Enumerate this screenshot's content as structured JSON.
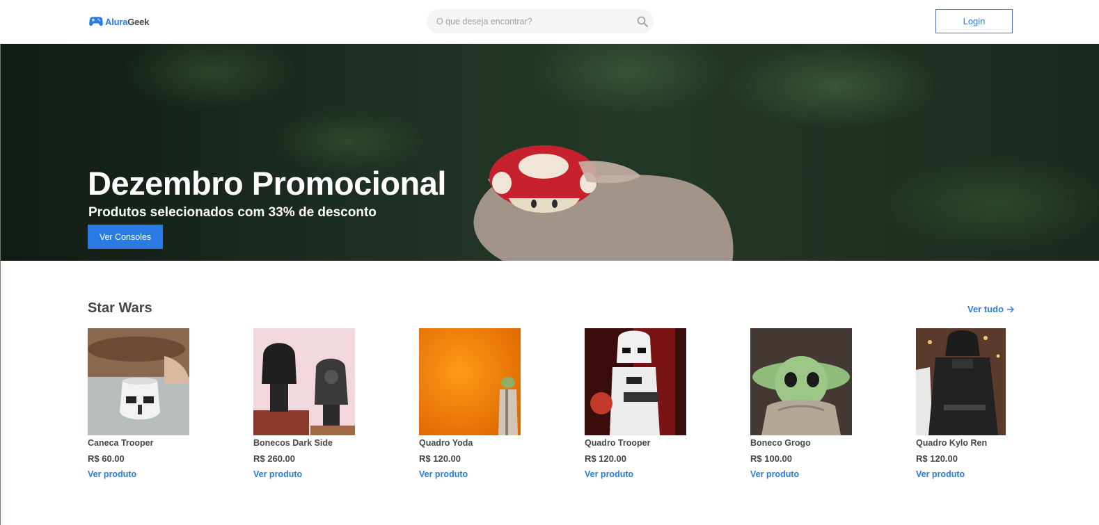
{
  "header": {
    "logo_part1": "Alura",
    "logo_part2": "Geek",
    "logo_icon": "gamepad-icon",
    "search_placeholder": "O que deseja encontrar?",
    "search_icon": "search-icon",
    "login_label": "Login"
  },
  "hero": {
    "title": "Dezembro Promocional",
    "subtitle": "Produtos selecionados com 33% de desconto",
    "button_label": "Ver Consoles"
  },
  "section": {
    "title": "Star Wars",
    "see_all_label": "Ver tudo",
    "see_all_icon": "arrow-right-icon",
    "products": [
      {
        "name": "Caneca Trooper",
        "price": "R$ 60.00",
        "link": "Ver produto"
      },
      {
        "name": "Bonecos Dark Side",
        "price": "R$ 260.00",
        "link": "Ver produto"
      },
      {
        "name": "Quadro Yoda",
        "price": "R$ 120.00",
        "link": "Ver produto"
      },
      {
        "name": "Quadro Trooper",
        "price": "R$ 120.00",
        "link": "Ver produto"
      },
      {
        "name": "Boneco Grogo",
        "price": "R$ 100.00",
        "link": "Ver produto"
      },
      {
        "name": "Quadro Kylo Ren",
        "price": "R$ 120.00",
        "link": "Ver produto"
      }
    ]
  },
  "colors": {
    "accent": "#2a7ae4",
    "text": "#464646",
    "search_bg": "#f5f5f5"
  }
}
